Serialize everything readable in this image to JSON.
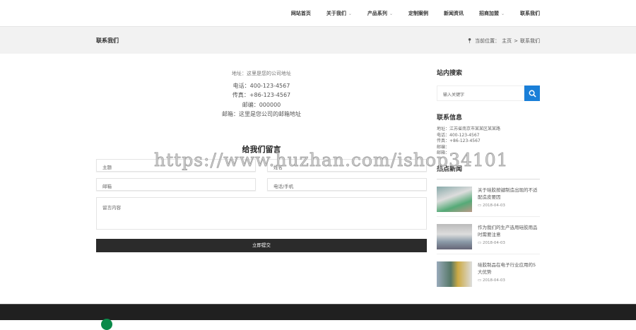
{
  "nav": {
    "items": [
      {
        "label": "网站首页",
        "dropdown": false
      },
      {
        "label": "关于我们",
        "dropdown": true
      },
      {
        "label": "产品系列",
        "dropdown": true
      },
      {
        "label": "定制案例",
        "dropdown": false
      },
      {
        "label": "新闻资讯",
        "dropdown": false
      },
      {
        "label": "招商加盟",
        "dropdown": true
      },
      {
        "label": "联系我们",
        "dropdown": false
      }
    ]
  },
  "banner": {
    "title": "联系我们",
    "crumb_prefix": "当前位置：",
    "crumb_home": "主页",
    "crumb_sep": ">",
    "crumb_current": "联系我们"
  },
  "info": {
    "address": "地址：这里是您的公司地址",
    "phone": "电话：400-123-4567",
    "fax": "传真：+86-123-4567",
    "zip": "邮编：000000",
    "email": "邮箱：这里是您公司的邮箱地址"
  },
  "form": {
    "title": "给我们留言",
    "subject_placeholder": "主题",
    "name_placeholder": "姓名",
    "email_placeholder": "邮箱",
    "phone_placeholder": "电话/手机",
    "message_placeholder": "留言内容",
    "submit_label": "立即提交"
  },
  "sidebar": {
    "search_title": "站内搜索",
    "search_placeholder": "输入关键字",
    "contact_title": "联系信息",
    "contact": [
      "地址：江苏省南京市某某区某某路",
      "电话：400-123-4567",
      "传真：+86-123-4567",
      "邮编：",
      "邮箱："
    ],
    "news_title": "热点新闻",
    "news": [
      {
        "title": "关于硅胶按键制造出现的不适配造皮要因",
        "date": "2018-04-03"
      },
      {
        "title": "作为我们的生产选用硅胶用品时需要注意",
        "date": "2018-04-03"
      },
      {
        "title": "硅胶制品在电子行业应用的5大优势",
        "date": "2018-04-03"
      }
    ]
  },
  "watermark": "https://www.huzhan.com/ishop34101",
  "colors": {
    "accent": "#1a7fd8",
    "button": "#2b2b2b",
    "footer": "#202020"
  }
}
